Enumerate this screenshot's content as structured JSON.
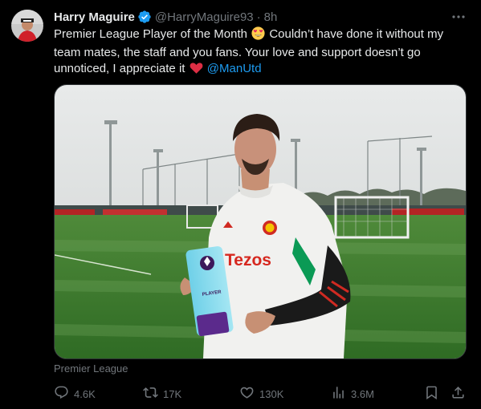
{
  "author": {
    "display_name": "Harry Maguire",
    "handle": "@HarryMaguire93",
    "separator": "·",
    "time": "8h",
    "verified": true
  },
  "tweet": {
    "text_part1": "Premier League Player of the Month",
    "emoji1": "heart-eyes-emoji",
    "text_part2": "Couldn’t have done it without my team mates, the staff and you fans. Your love and support doesn’t go unnoticed, I appreciate it",
    "emoji2": "red-heart-emoji",
    "mention": "@ManUtd"
  },
  "media": {
    "caption": "Premier League",
    "sponsor_text": "Tezos",
    "trophy_label": "PLAYER"
  },
  "actions": {
    "replies": "4.6K",
    "reposts": "17K",
    "likes": "130K",
    "views": "3.6M"
  },
  "colors": {
    "background": "#000000",
    "text": "#e7e9ea",
    "muted": "#71767b",
    "link": "#1d9bf0",
    "verified": "#1d9bf0",
    "heart": "#f91880"
  }
}
